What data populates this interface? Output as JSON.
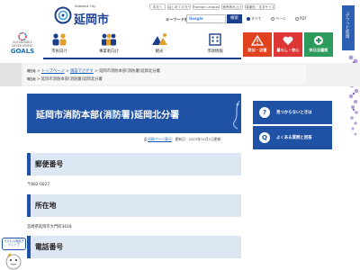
{
  "header": {
    "logo_sub": "Nobeoka City",
    "logo_name": "延岡市",
    "utility_links": [
      "本文へ",
      "はじめての方へ",
      "Foreign Language",
      "音声読み上げ",
      "背景色・文字サイズ"
    ],
    "keyword_label": "キーワード検索",
    "search_placeholder": "Google",
    "search_button": "検索",
    "search_scopes": [
      "すべて",
      "ページ",
      "PDF"
    ]
  },
  "nav": {
    "sdgs_line1": "SUSTAINABLE DEVELOPMENT",
    "sdgs_line2": "GOALS",
    "items": [
      {
        "label": "市民向け",
        "icon": "people-icon"
      },
      {
        "label": "事業者向け",
        "icon": "business-people-icon"
      },
      {
        "label": "観光",
        "icon": "sightseeing-icon"
      },
      {
        "label": "市政情報",
        "icon": "city-hall-icon"
      }
    ],
    "tiles": [
      {
        "label": "防災・災害",
        "icon": "warning-icon",
        "color": "#e0411f"
      },
      {
        "label": "暮らし・安心",
        "icon": "heart-icon",
        "color": "#de3535"
      },
      {
        "label": "休日当番医",
        "icon": "medical-cross-icon",
        "color": "#2c9b5b"
      }
    ]
  },
  "breadcrumb": {
    "home": "トップページ",
    "sep": ">",
    "level1": "施設でさがす",
    "current": "延岡市消防本部(消防署)延岡北分署",
    "here_label": "現在地",
    "current_full": "延岡市消防本部(消防署)延岡北分署"
  },
  "page": {
    "title": "延岡市消防本部(消防署)延岡北分署",
    "print_label": "印刷ページ表示",
    "updated": "更新日：2023年11月1日更新",
    "sections": [
      {
        "heading": "郵便番号",
        "text": "〒882-0027"
      },
      {
        "heading": "所在地",
        "text": "宮崎県延岡市大門町3618"
      },
      {
        "heading": "電話番号",
        "text": ""
      }
    ]
  },
  "sidebar": {
    "buttons": [
      {
        "label": "見つからないときは",
        "icon": "search-icon",
        "glyph": "?"
      },
      {
        "label": "よくある質問と回答",
        "icon": "question-icon",
        "glyph": "Q"
      }
    ]
  },
  "right_strip": {
    "label": "ぶらっと延岡"
  },
  "mascot": {
    "bubble": "すらむん相談チャットで"
  },
  "colors": {
    "primary": "#1f52a5",
    "accent_red": "#de3535",
    "accent_green": "#2c9b5b",
    "link": "#1a5fb4"
  }
}
